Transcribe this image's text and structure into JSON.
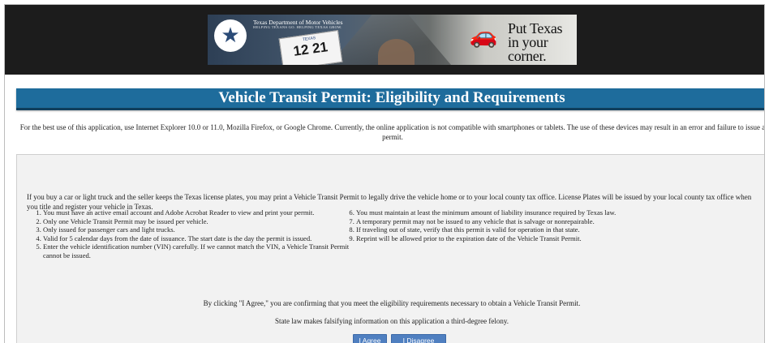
{
  "header": {
    "dept_name": "Texas Department of Motor Vehicles",
    "dept_tagline": "HELPING TEXANS GO. HELPING TEXAS GROW.",
    "plate_state": "TEXAS",
    "plate_number": "12 21",
    "slogan": "Put Texas in your corner.",
    "icons": {
      "logo": "star-icon",
      "car": "car-icon"
    }
  },
  "title": "Vehicle Transit Permit: Eligibility and Requirements",
  "browser_note": "For the best use of this application, use Internet Explorer 10.0 or 11.0, Mozilla Firefox, or Google Chrome. Currently, the online application is not compatible with smartphones or tablets. The use of these devices may result in an error and failure to issue a permit.",
  "intro": "If you buy a car or light truck and the seller keeps the Texas license plates, you may print a Vehicle Transit Permit to legally drive the vehicle home or to your local county tax office. License Plates will be issued by your local county tax office when you title and register your vehicle in Texas.",
  "requirements_left": [
    "You must have an active email account and Adobe Acrobat Reader to view and print your permit.",
    "Only one Vehicle Transit Permit may be issued per vehicle.",
    "Only issued for passenger cars and light trucks.",
    "Valid for 5 calendar days from the date of issuance. The start date is the day the permit is issued.",
    "Enter the vehicle identification number (VIN) carefully. If we cannot match the VIN, a Vehicle Transit Permit cannot be issued."
  ],
  "requirements_right": [
    "You must maintain at least the minimum amount of liability insurance required by Texas law.",
    "A temporary permit may not be issued to any vehicle that is salvage or nonrepairable.",
    "If traveling out of state, verify that this permit is valid for operation in that state.",
    "Reprint will be allowed prior to the expiration date of the Vehicle Transit Permit."
  ],
  "agree_statement": "By clicking \"I Agree,\" you are confirming that you meet the eligibility requirements necessary to obtain a Vehicle Transit Permit.",
  "felony_statement": "State law makes falsifying information on this application a third-degree felony.",
  "buttons": {
    "agree": "I Agree",
    "disagree": "I Disagree"
  },
  "colors": {
    "title_bar": "#1e6c9c",
    "button": "#4f7fc0",
    "top_bar": "#1c1c1c",
    "panel": "#f2f2f2"
  }
}
